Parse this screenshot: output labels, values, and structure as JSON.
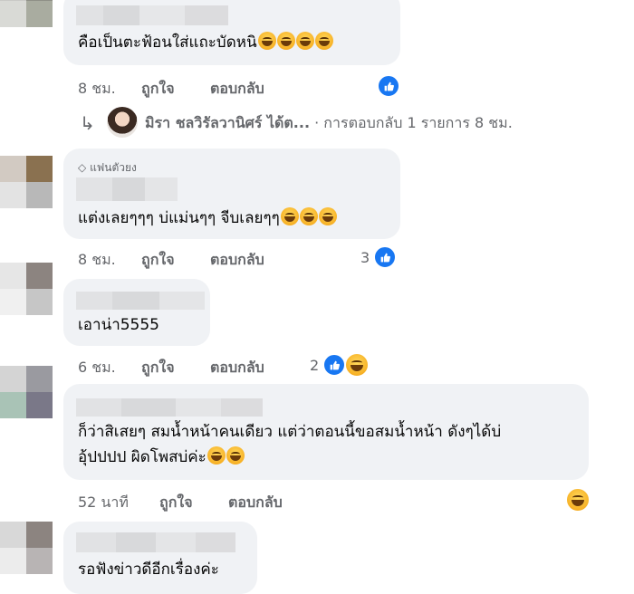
{
  "comments": [
    {
      "text": "คือเป็นตะฟ้อนใส่แถะบัดหนิ",
      "emoji_count": 4,
      "time": "8 ชม.",
      "like_label": "ถูกใจ",
      "reply_label": "ตอบกลับ",
      "reaction_count": ""
    },
    {
      "badge": "แฟนตัวยง",
      "text": "แต่งเลยๆๆๆ บ่แม่นๆๆ จีบเลยๆๆ",
      "emoji_count": 3,
      "time": "8 ชม.",
      "like_label": "ถูกใจ",
      "reply_label": "ตอบกลับ",
      "reaction_count": "3"
    },
    {
      "text": "เอาน่า5555",
      "time": "6 ชม.",
      "like_label": "ถูกใจ",
      "reply_label": "ตอบกลับ",
      "reaction_count": "2"
    },
    {
      "text_line1": "ก็ว่าสิเสยๆ สมน้ำหน้าคนเดียว แต่ว่าตอนนี้ขอสมน้ำหน้า ดังๆได้บ่",
      "text_line2": "อุ้ปปปป ผิดโพสบ่ค่ะ",
      "emoji_count": 2,
      "time": "52 นาที",
      "like_label": "ถูกใจ",
      "reply_label": "ตอบกลับ"
    },
    {
      "text": "รอฟังข่าวดีอีกเรื่องค่ะ"
    }
  ],
  "reply_preview": {
    "name": "มิรา ชลวิรัลวานิศร์ ได้ต...",
    "count_text": "· การตอบกลับ 1 รายการ 8 ชม."
  },
  "colors": {
    "bubble": "#f0f2f5",
    "meta_text": "#65676b",
    "like_blue": "#1877f2"
  },
  "icons": [
    "like-icon",
    "haha-icon",
    "reply-arrow-icon",
    "diamond-icon"
  ]
}
